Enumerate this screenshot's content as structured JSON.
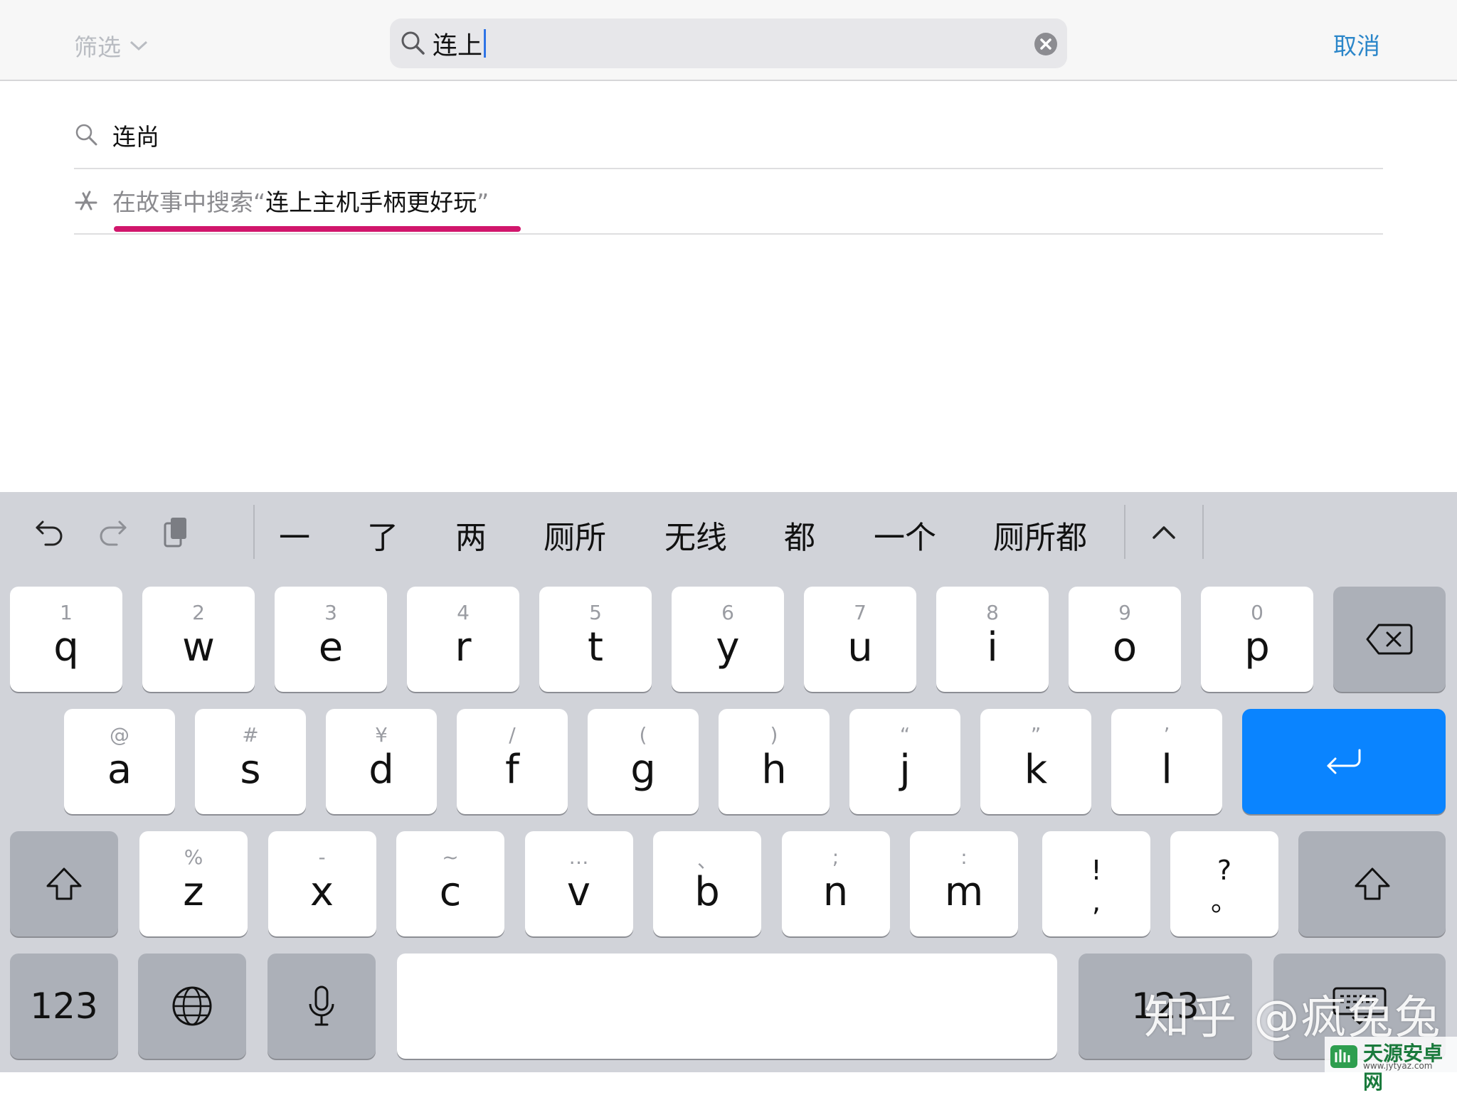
{
  "header": {
    "filter_label": "筛选",
    "search_query": "连上",
    "cancel_label": "取消"
  },
  "suggestions": [
    {
      "icon": "search-icon",
      "text": "连尚"
    },
    {
      "icon": "app-store-icon",
      "prefix": "在故事中搜索“",
      "highlight": "连上主机手柄更好玩",
      "suffix": "”"
    }
  ],
  "keyboard": {
    "candidates": [
      "一",
      "了",
      "两",
      "厕所",
      "无线",
      "都",
      "一个",
      "厕所都"
    ],
    "row1": [
      {
        "sub": "1",
        "main": "q"
      },
      {
        "sub": "2",
        "main": "w"
      },
      {
        "sub": "3",
        "main": "e"
      },
      {
        "sub": "4",
        "main": "r"
      },
      {
        "sub": "5",
        "main": "t"
      },
      {
        "sub": "6",
        "main": "y"
      },
      {
        "sub": "7",
        "main": "u"
      },
      {
        "sub": "8",
        "main": "i"
      },
      {
        "sub": "9",
        "main": "o"
      },
      {
        "sub": "0",
        "main": "p"
      }
    ],
    "row2": [
      {
        "sub": "@",
        "main": "a"
      },
      {
        "sub": "#",
        "main": "s"
      },
      {
        "sub": "¥",
        "main": "d"
      },
      {
        "sub": "/",
        "main": "f"
      },
      {
        "sub": "(",
        "main": "g"
      },
      {
        "sub": ")",
        "main": "h"
      },
      {
        "sub": "“",
        "main": "j"
      },
      {
        "sub": "”",
        "main": "k"
      },
      {
        "sub": "’",
        "main": "l"
      }
    ],
    "row3": [
      {
        "sub": "%",
        "main": "z"
      },
      {
        "sub": "-",
        "main": "x"
      },
      {
        "sub": "~",
        "main": "c"
      },
      {
        "sub": "…",
        "main": "v"
      },
      {
        "sub": "、",
        "main": "b"
      },
      {
        "sub": ";",
        "main": "n"
      },
      {
        "sub": ":",
        "main": "m"
      }
    ],
    "punct": [
      {
        "top": "!",
        "bottom": ","
      },
      {
        "top": "?",
        "bottom": "。"
      }
    ],
    "numbers_label": "123",
    "numbers_label_right": "123"
  },
  "watermark": {
    "text": "知乎 @疯兔兔",
    "logo_title": "天源安卓网",
    "logo_url": "www.jytyaz.com"
  },
  "colors": {
    "accent_blue": "#0a84ff",
    "cancel_blue": "#2b86c9",
    "highlight_underline": "#d1166c"
  }
}
